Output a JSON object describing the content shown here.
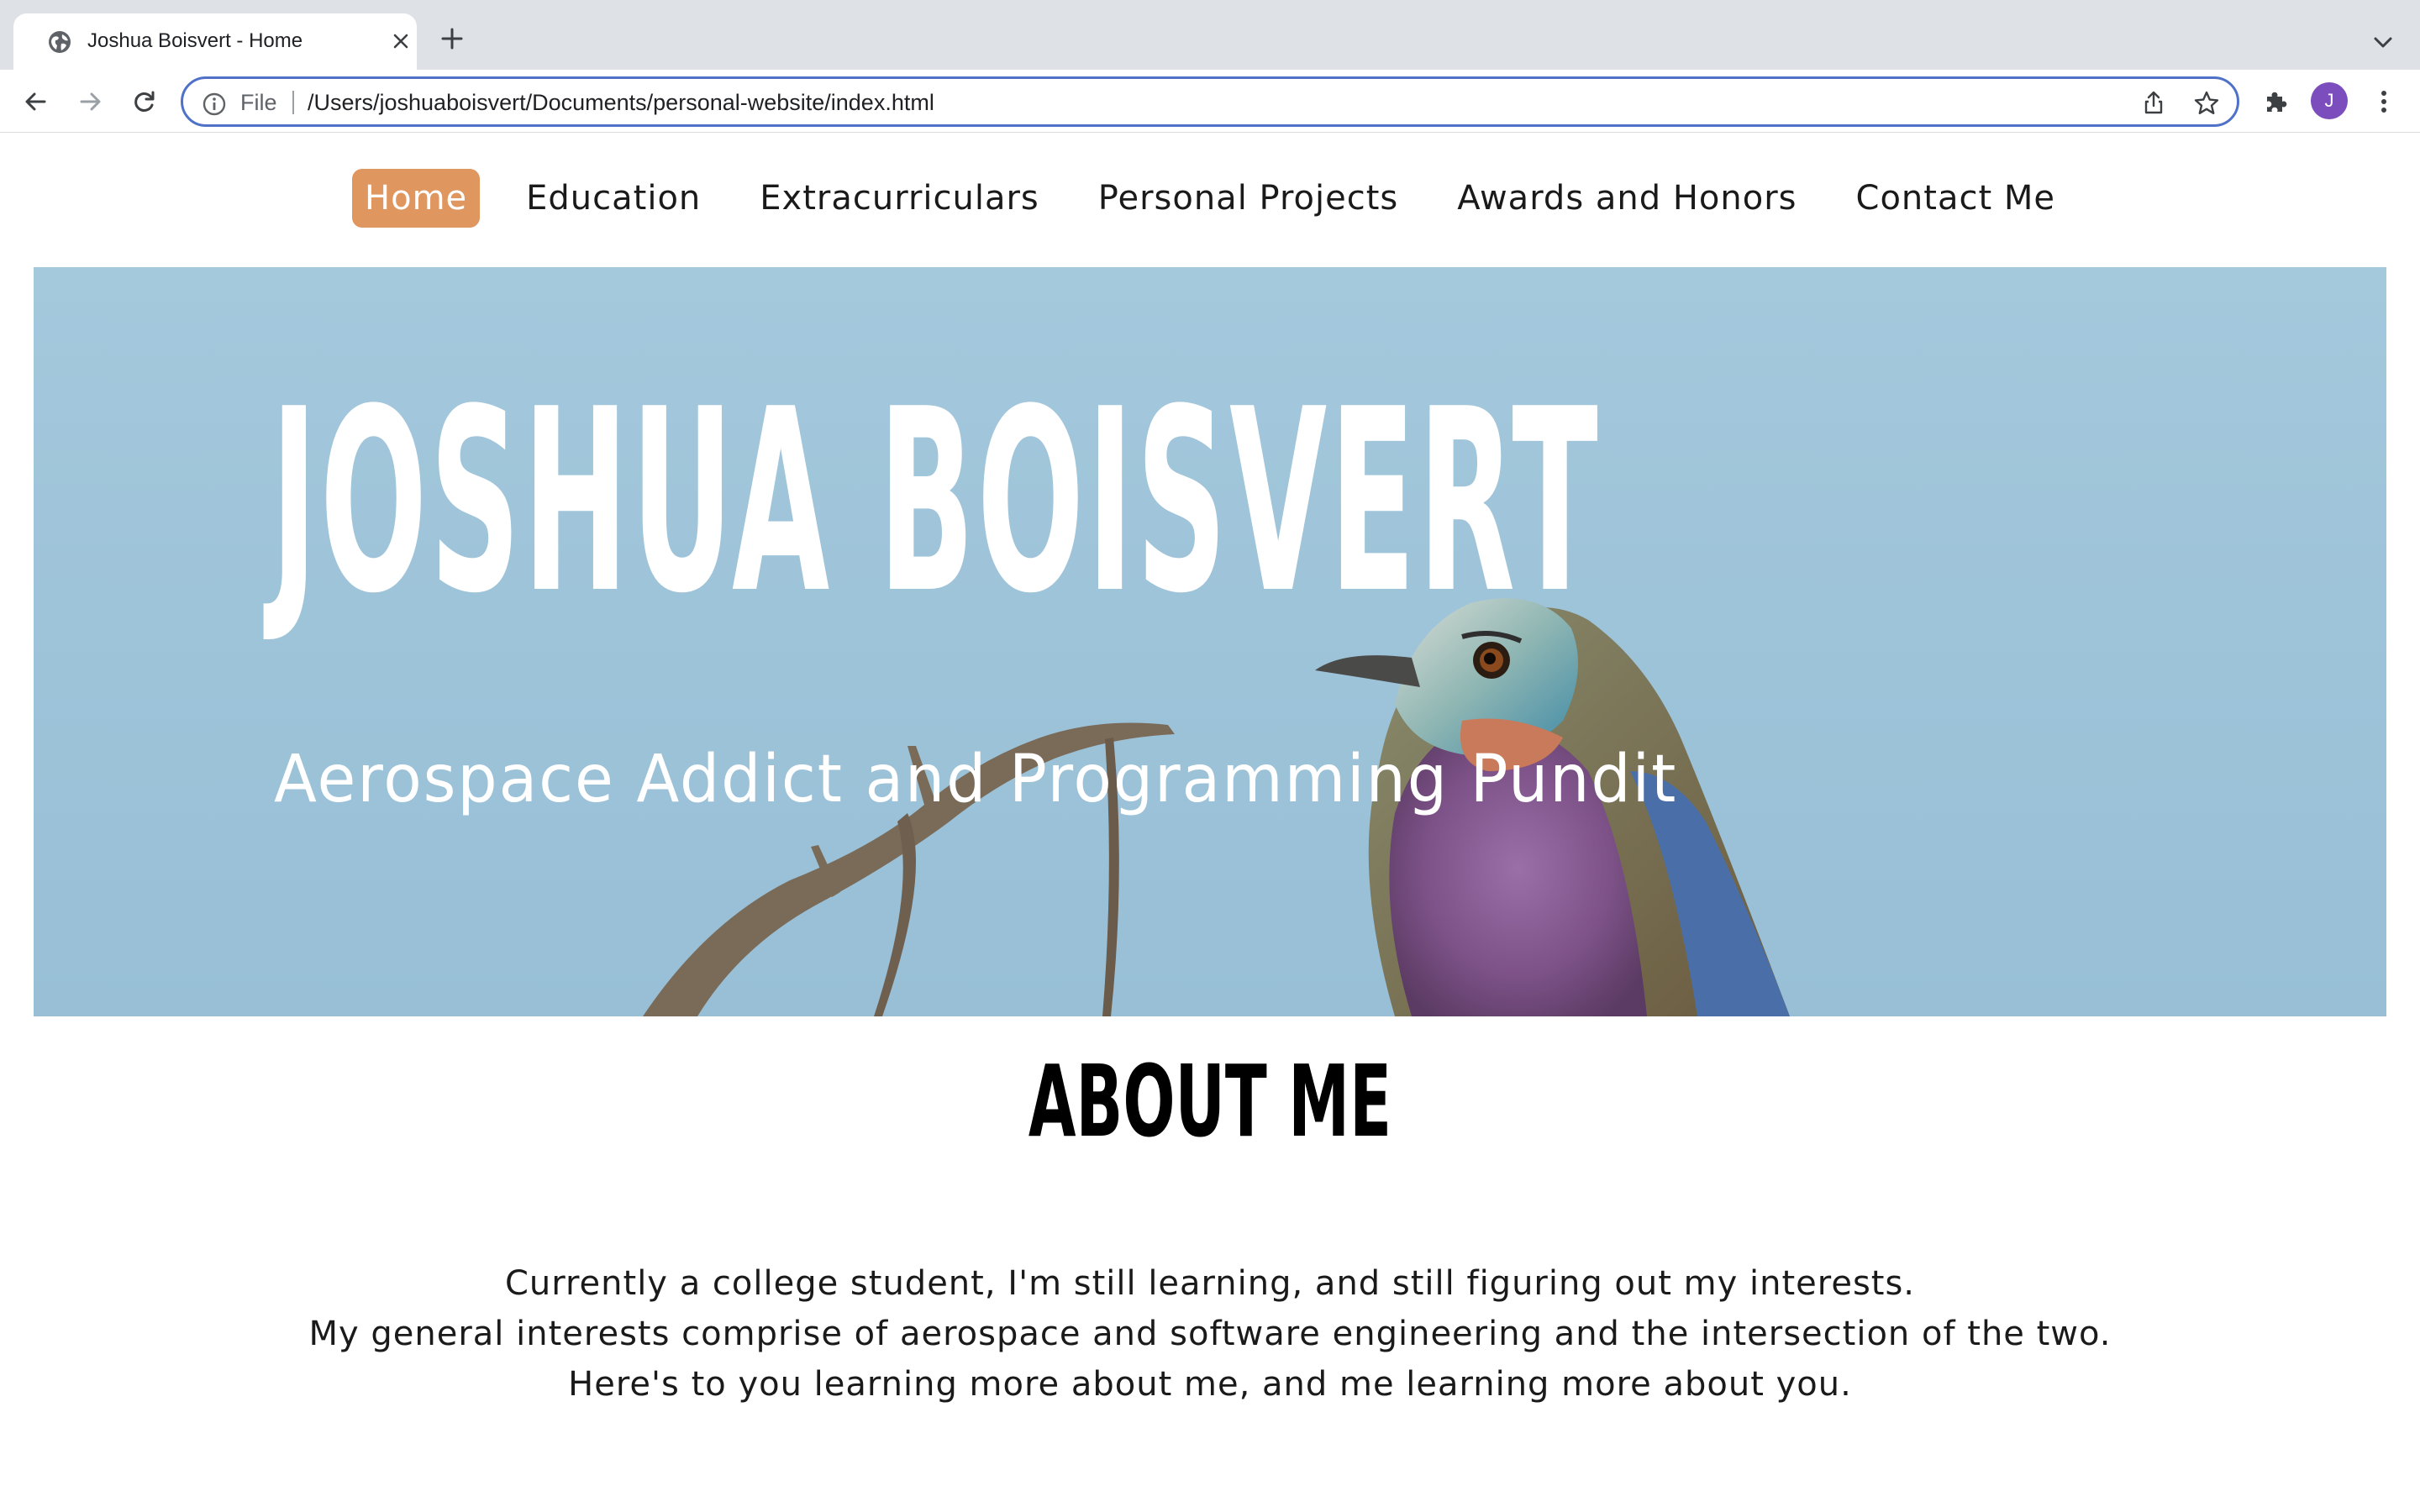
{
  "browser": {
    "tab": {
      "title": "Joshua Boisvert - Home",
      "favicon": "globe-icon"
    },
    "address_bar": {
      "scheme_label": "File",
      "url": "/Users/joshuaboisvert/Documents/personal-website/index.html"
    },
    "profile_initial": "J",
    "icons": [
      "close-icon",
      "plus-icon",
      "chevron-down-icon",
      "back-arrow-icon",
      "forward-arrow-icon",
      "reload-icon",
      "info-icon",
      "share-icon",
      "star-icon",
      "puzzle-icon",
      "kebab-menu-icon"
    ]
  },
  "site": {
    "nav": {
      "items": [
        {
          "label": "Home",
          "active": true
        },
        {
          "label": "Education"
        },
        {
          "label": "Extracurriculars"
        },
        {
          "label": "Personal Projects"
        },
        {
          "label": "Awards and Honors"
        },
        {
          "label": "Contact Me"
        }
      ],
      "active_color": "#e0965f"
    },
    "hero": {
      "name": "JOSHUA BOISVERT",
      "tagline": "Aerospace Addict and Programming Pundit",
      "background_color": "#a4c8dc",
      "image": "lilac-breasted-roller-bird-on-branch"
    },
    "about": {
      "title": "ABOUT ME",
      "lines": [
        "Currently a college student, I'm still learning, and still figuring out my interests.",
        "My general interests comprise of aerospace and software engineering and the intersection of the two.",
        "Here's to you learning more about me, and me learning more about you."
      ]
    }
  }
}
